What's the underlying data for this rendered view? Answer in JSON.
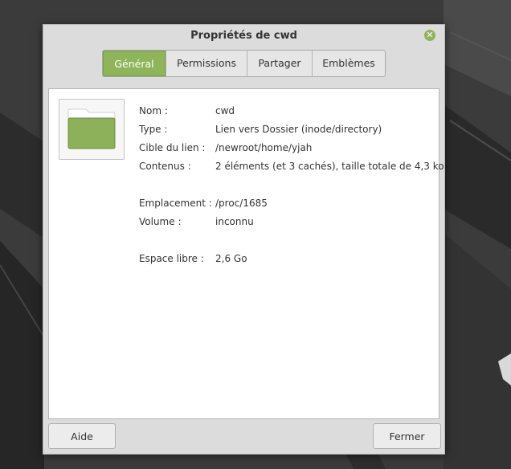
{
  "window": {
    "title": "Propriétés de cwd",
    "close_icon": "close-icon"
  },
  "tabs": [
    {
      "label": "Général",
      "active": true
    },
    {
      "label": "Permissions",
      "active": false
    },
    {
      "label": "Partager",
      "active": false
    },
    {
      "label": "Emblèmes",
      "active": false
    }
  ],
  "file_icon": "folder-icon",
  "properties": {
    "name": {
      "label": "Nom :",
      "value": "cwd"
    },
    "type": {
      "label": "Type :",
      "value": "Lien vers Dossier (inode/directory)"
    },
    "link_target": {
      "label": "Cible du lien :",
      "value": "/newroot/home/yjah"
    },
    "contents": {
      "label": "Contenus :",
      "value": "2 éléments (et 3 cachés), taille totale de 4,3 ko"
    },
    "location": {
      "label": "Emplacement :",
      "value": "/proc/1685"
    },
    "volume": {
      "label": "Volume :",
      "value": "inconnu"
    },
    "free_space": {
      "label": "Espace libre :",
      "value": "2,6 Go"
    }
  },
  "buttons": {
    "help": "Aide",
    "close": "Fermer"
  },
  "colors": {
    "accent": "#8fb55b",
    "folder": "#8db05a"
  }
}
